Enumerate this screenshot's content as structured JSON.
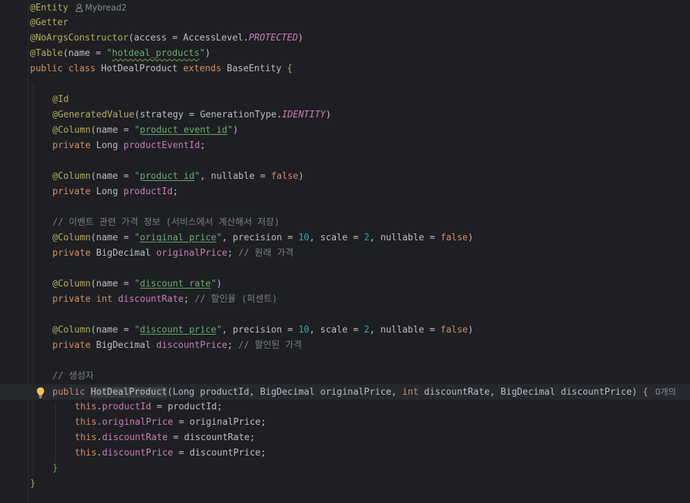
{
  "editor": {
    "author": "Mybread2",
    "usages_hint": "0개의",
    "lines": {
      "l1": "@Entity",
      "l2": "@Getter",
      "l3": {
        "a": "@NoArgsConstructor",
        "b": "(access = AccessLevel.",
        "c": "PROTECTED",
        "d": ")"
      },
      "l4": {
        "a": "@Table",
        "b": "(name = ",
        "c": "\"",
        "d": "hotdeal_products",
        "e": "\"",
        ")": ")"
      },
      "l5": {
        "a": "public class ",
        "b": "HotDealProduct ",
        "c": "extends ",
        "d": "BaseEntity ",
        "e": "{"
      },
      "l7": "@Id",
      "l8": {
        "a": "@GeneratedValue",
        "b": "(strategy = GenerationType.",
        "c": "IDENTITY",
        "d": ")"
      },
      "l9": {
        "a": "@Column",
        "b": "(name = ",
        "c": "\"",
        "d": "product_event_id",
        "e": "\"",
        "f": ")"
      },
      "l10": {
        "a": "private ",
        "b": "Long ",
        "c": "productEventId",
        ";": ";"
      },
      "l12": {
        "a": "@Column",
        "b": "(name = ",
        "c": "\"",
        "d": "product_id",
        "e": "\"",
        ",": ", nullable = ",
        "f": "false",
        ")": ")"
      },
      "l13": {
        "a": "private ",
        "b": "Long ",
        "c": "productId",
        ";": ";"
      },
      "l15": "// 이벤트 관련 가격 정보 (서비스에서 계산해서 저장)",
      "l16": {
        "a": "@Column",
        "b": "(name = ",
        "c": "\"",
        "d": "original_price",
        "e": "\"",
        "f": ", precision = ",
        "g": "10",
        "h": ", scale = ",
        "i": "2",
        "j": ", nullable = ",
        "k": "false",
        "l": ")"
      },
      "l17": {
        "a": "private ",
        "b": "BigDecimal ",
        "c": "originalPrice",
        "d": "; ",
        "e": "// 원래 가격"
      },
      "l19": {
        "a": "@Column",
        "b": "(name = ",
        "c": "\"",
        "d": "discount_rate",
        "e": "\"",
        "f": ")"
      },
      "l20": {
        "a": "private ",
        "b": "int ",
        "c": "discountRate",
        "d": "; ",
        "e": "// 할인율 (퍼센트)"
      },
      "l22": {
        "a": "@Column",
        "b": "(name = ",
        "c": "\"",
        "d": "discount_price",
        "e": "\"",
        "f": ", precision = ",
        "g": "10",
        "h": ", scale = ",
        "i": "2",
        "j": ", nullable = ",
        "k": "false",
        "l": ")"
      },
      "l23": {
        "a": "private ",
        "b": "BigDecimal ",
        "c": "discountPrice",
        "d": "; ",
        "e": "// 할인된 가격"
      },
      "l25": "// 생성자",
      "l26": {
        "a": "public ",
        "b": "HotDealProduct",
        "c": "(Long productId, BigDecimal originalPrice, ",
        "d": "int ",
        "e": "discountRate, BigDecimal discountPrice) ",
        "f": "{"
      },
      "l27": {
        "a": "this",
        "b": ".",
        "c": "productId",
        "d": " = productId;"
      },
      "l28": {
        "a": "this",
        "b": ".",
        "c": "originalPrice",
        "d": " = originalPrice;"
      },
      "l29": {
        "a": "this",
        "b": ".",
        "c": "discountRate",
        "d": " = discountRate;"
      },
      "l30": {
        "a": "this",
        "b": ".",
        "c": "discountPrice",
        "d": " = discountPrice;"
      },
      "l31": "}",
      "l32": "}"
    }
  },
  "colors": {
    "background": "#1e1f22",
    "annotation": "#b3ae60",
    "keyword": "#cf8e6d",
    "string": "#6aab73",
    "number": "#2aacb8",
    "field": "#c77dbb",
    "comment": "#7a7e85",
    "text": "#bcbec4"
  }
}
